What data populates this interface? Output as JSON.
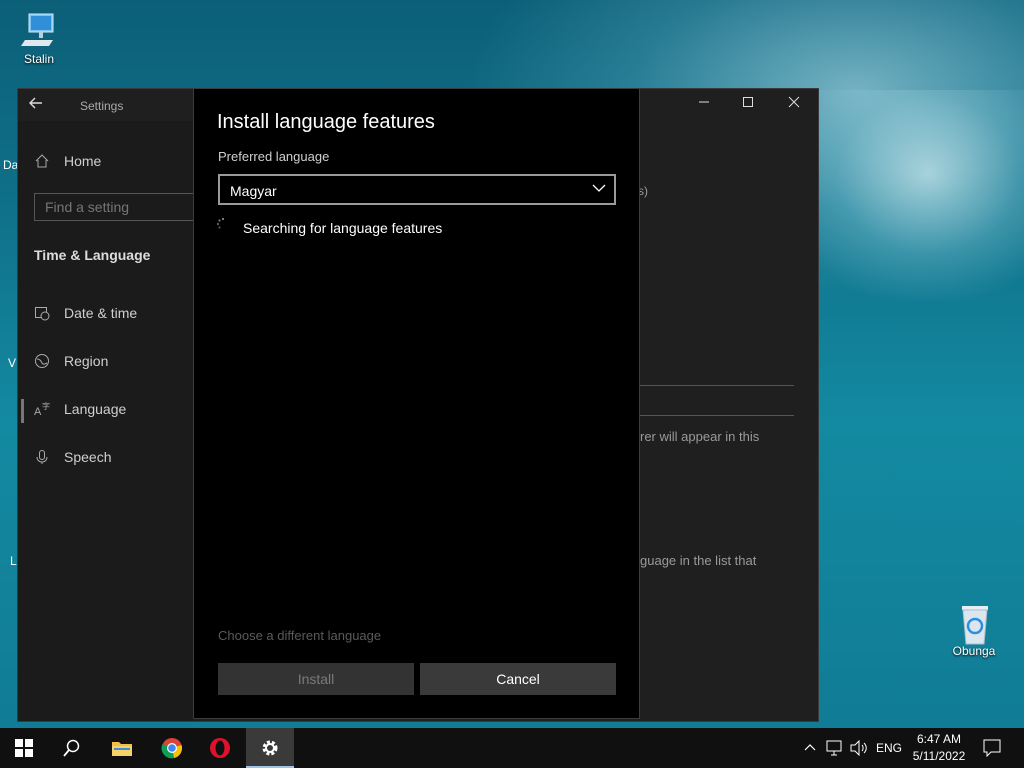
{
  "desktop": {
    "icons": [
      {
        "label": "Stalin",
        "icon": "computer-icon"
      },
      {
        "label": "Obunga",
        "icon": "recycle-bin-icon"
      }
    ],
    "edge_letters": [
      "Da",
      "V",
      "L"
    ]
  },
  "settings_window": {
    "title": "Settings",
    "home_label": "Home",
    "search_placeholder": "Find a setting",
    "section_title": "Time & Language",
    "nav": [
      {
        "label": "Date & time",
        "icon": "calendar-clock-icon"
      },
      {
        "label": "Region",
        "icon": "globe-icon"
      },
      {
        "label": "Language",
        "icon": "language-icon"
      },
      {
        "label": "Speech",
        "icon": "microphone-icon"
      }
    ],
    "bg_fragments": {
      "paren": "s)",
      "text1": "rer will appear in this",
      "text2": "guage in the list that"
    }
  },
  "dialog": {
    "title": "Install language features",
    "preferred_label": "Preferred language",
    "selected_language": "Magyar",
    "status": "Searching for language features",
    "choose_link": "Choose a different language",
    "install_label": "Install",
    "cancel_label": "Cancel"
  },
  "taskbar": {
    "apps": [
      "start-icon",
      "search-icon",
      "file-explorer-icon",
      "chrome-icon",
      "opera-icon",
      "settings-gear-icon"
    ],
    "tray": {
      "language": "ENG",
      "time": "6:47 AM",
      "date": "5/11/2022"
    }
  }
}
